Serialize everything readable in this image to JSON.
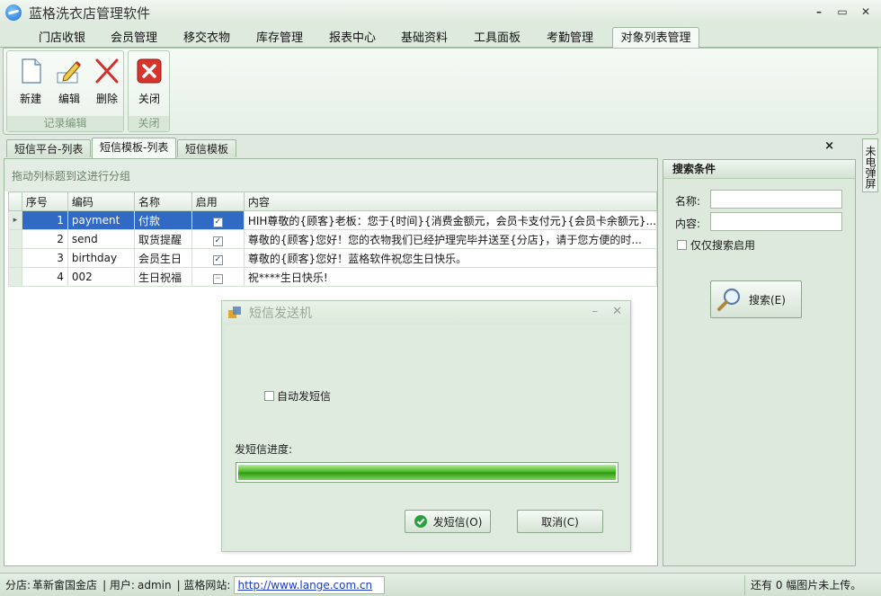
{
  "app": {
    "title": "蓝格洗衣店管理软件"
  },
  "window_controls": {
    "minimize": "–",
    "maximize": "▭",
    "close": "✕"
  },
  "ribbon_tabs": [
    {
      "label": "门店收银"
    },
    {
      "label": "会员管理"
    },
    {
      "label": "移交衣物"
    },
    {
      "label": "库存管理"
    },
    {
      "label": "报表中心"
    },
    {
      "label": "基础资料"
    },
    {
      "label": "工具面板"
    },
    {
      "label": "考勤管理"
    },
    {
      "label": "对象列表管理",
      "active": true
    }
  ],
  "ribbon": {
    "record_group": {
      "label": "记录编辑",
      "buttons": {
        "new": "新建",
        "edit": "编辑",
        "delete": "删除"
      }
    },
    "close_group": {
      "label": "关闭",
      "buttons": {
        "close": "关闭"
      }
    }
  },
  "doc_tabs": [
    {
      "label": "短信平台-列表"
    },
    {
      "label": "短信模板-列表",
      "active": true
    },
    {
      "label": "短信模板"
    }
  ],
  "doc_close": "×",
  "side_tab": "未电弹屏",
  "grid": {
    "group_hint": "拖动列标题到这进行分组",
    "columns": [
      "序号",
      "编码",
      "名称",
      "启用",
      "内容"
    ],
    "rows": [
      {
        "no": "1",
        "code": "payment",
        "name": "付款",
        "enabled": true,
        "content": "HIH尊敬的{顾客}老板：您于{时间}{消费金额元，会员卡支付元}{会员卡余额元}..."
      },
      {
        "no": "2",
        "code": "send",
        "name": "取货提醒",
        "enabled": true,
        "content": "尊敬的{顾客}您好！您的衣物我们已经护理完毕并送至{分店}，请于您方便的时..."
      },
      {
        "no": "3",
        "code": "birthday",
        "name": "会员生日",
        "enabled": true,
        "content": "尊敬的{顾客}您好！蓝格软件祝您生日快乐。"
      },
      {
        "no": "4",
        "code": "002",
        "name": "生日祝福",
        "enabled": false,
        "content": "祝****生日快乐!"
      }
    ]
  },
  "search": {
    "title": "搜索条件",
    "name_label": "名称:",
    "content_label": "内容:",
    "enabled_only_label": "仅仅搜索启用",
    "search_button": "搜索(E)"
  },
  "dialog": {
    "title": "短信发送机",
    "auto_send_label": "自动发短信",
    "progress_label": "发短信进度:",
    "progress": 1.0,
    "send_button": "发短信(O)",
    "cancel_button": "取消(C)"
  },
  "status": {
    "store_label": "分店:",
    "store": "革新畲国金店",
    "user_label": "| 用户:",
    "user": "admin",
    "site_label": "| 蓝格网站:",
    "site_url": "http://www.lange.com.cn",
    "upload_note": "还有 0 幅图片未上传。"
  }
}
